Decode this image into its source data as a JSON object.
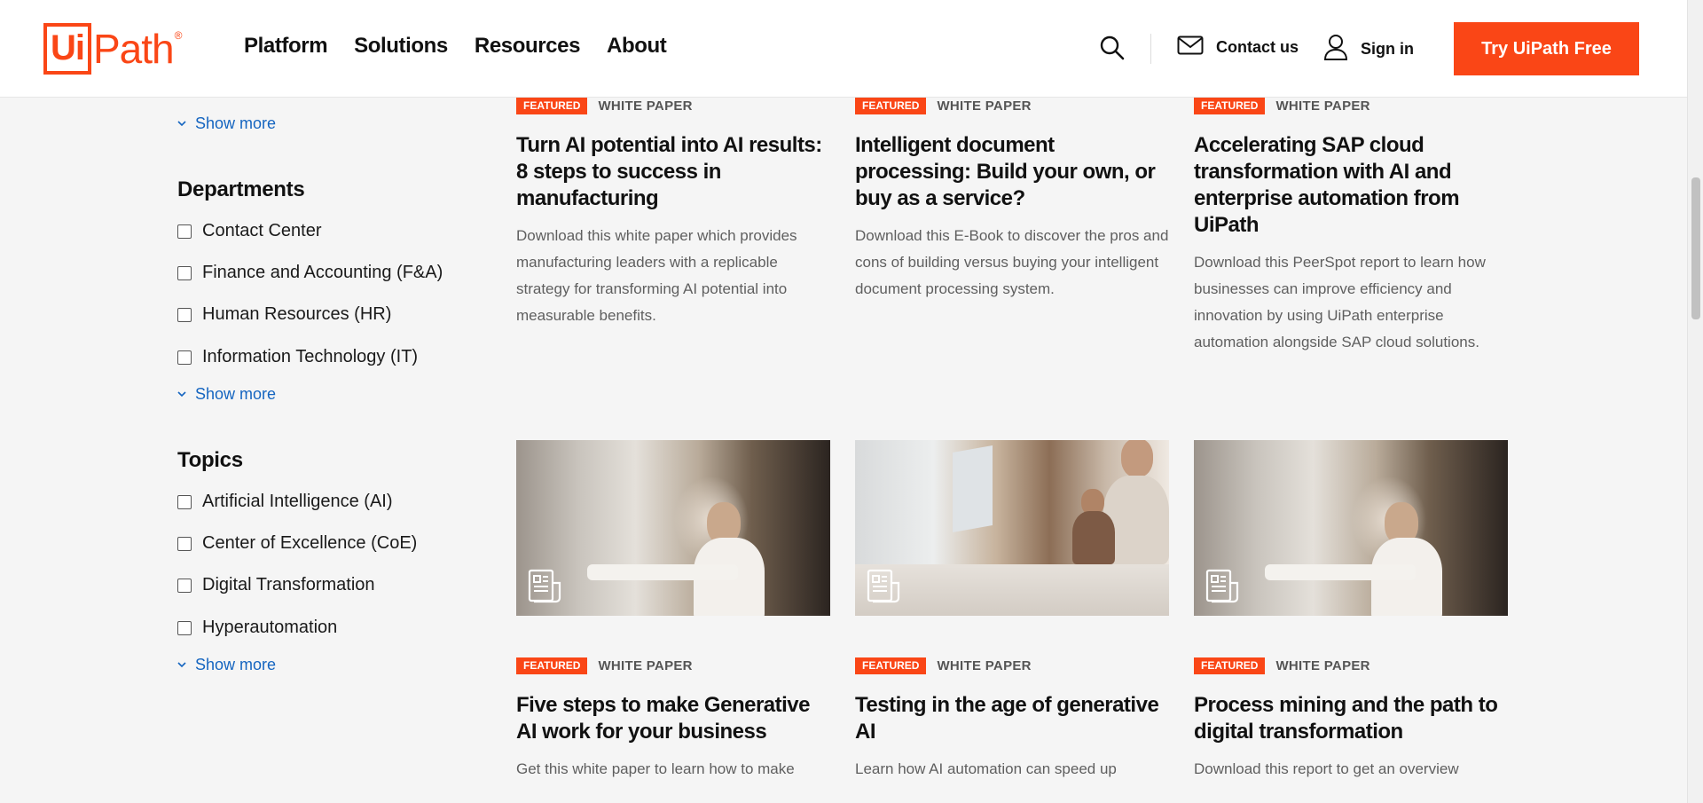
{
  "header": {
    "logo_text": "UiPath",
    "nav": [
      "Platform",
      "Solutions",
      "Resources",
      "About"
    ],
    "contact_label": "Contact us",
    "signin_label": "Sign in",
    "cta_label": "Try UiPath Free"
  },
  "sidebar": {
    "show_more_label": "Show more",
    "departments": {
      "title": "Departments",
      "items": [
        "Contact Center",
        "Finance and Accounting (F&A)",
        "Human Resources (HR)",
        "Information Technology (IT)"
      ]
    },
    "topics": {
      "title": "Topics",
      "items": [
        "Artificial Intelligence (AI)",
        "Center of Excellence (CoE)",
        "Digital Transformation",
        "Hyperautomation"
      ]
    }
  },
  "cards": [
    {
      "featured": "FEATURED",
      "type": "WHITE PAPER",
      "title": "Turn AI potential into AI results: 8 steps to success in manufacturing",
      "desc": "Download this white paper which provides manufacturing leaders with a replicable strategy for transforming AI potential into measurable benefits."
    },
    {
      "featured": "FEATURED",
      "type": "WHITE PAPER",
      "title": "Intelligent document processing: Build your own, or buy as a service?",
      "desc": "Download this E-Book to discover the pros and cons of building versus buying your intelligent document processing system."
    },
    {
      "featured": "FEATURED",
      "type": "WHITE PAPER",
      "title": "Accelerating SAP cloud transformation with AI and enterprise automation from UiPath",
      "desc": "Download this PeerSpot report to learn how businesses can improve efficiency and innovation by using UiPath enterprise automation alongside SAP cloud solutions."
    },
    {
      "featured": "FEATURED",
      "type": "WHITE PAPER",
      "title": "Five steps to make Generative AI work for your business",
      "desc": "Get this white paper to learn how to make"
    },
    {
      "featured": "FEATURED",
      "type": "WHITE PAPER",
      "title": "Testing in the age of generative AI",
      "desc": "Learn how AI automation can speed up"
    },
    {
      "featured": "FEATURED",
      "type": "WHITE PAPER",
      "title": "Process mining and the path to digital transformation",
      "desc": "Download this report to get an overview"
    }
  ],
  "colors": {
    "brand": "#fa4616",
    "link": "#1565c0"
  },
  "icons": [
    "search-icon",
    "mail-icon",
    "user-icon",
    "chevron-down-icon",
    "document-icon"
  ]
}
